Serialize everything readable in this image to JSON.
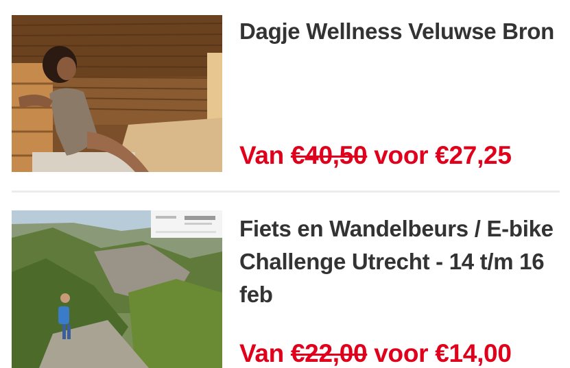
{
  "deals": [
    {
      "title": "Dagje Wellness Veluwse Bron",
      "price_prefix": "Van",
      "old_price": "€40,50",
      "price_mid": "voor",
      "new_price": "€27,25",
      "image": "sauna-photo"
    },
    {
      "title": "Fiets en Wandelbeurs / E-bike Challenge Utrecht - 14 t/m 16 feb",
      "price_prefix": "Van",
      "old_price": "€22,00",
      "price_mid": "voor",
      "new_price": "€14,00",
      "image": "hiking-landscape-photo"
    }
  ],
  "colors": {
    "price": "#e0001b",
    "title": "#333333",
    "divider": "#ececec"
  }
}
